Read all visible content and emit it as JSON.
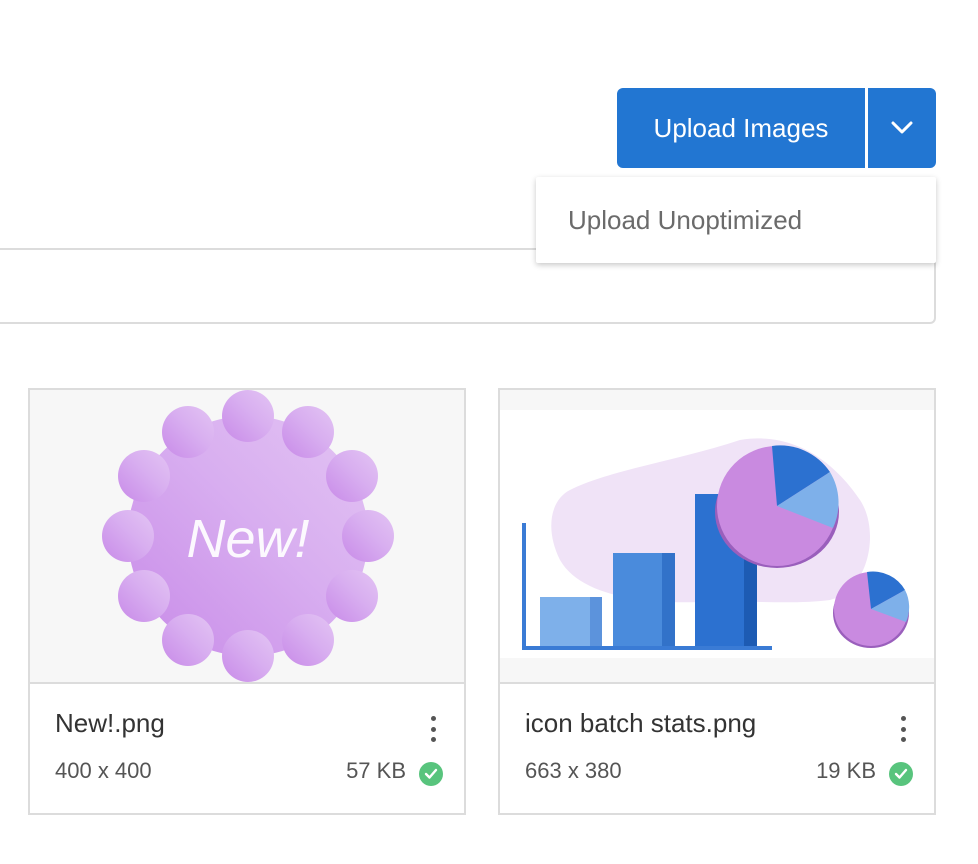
{
  "toolbar": {
    "upload_label": "Upload Images",
    "dropdown_icon": "chevron-down-icon",
    "dropdown_items": [
      "Upload Unoptimized"
    ]
  },
  "images": [
    {
      "name": "New!.png",
      "dimensions": "400 x 400",
      "size": "57 KB",
      "status_icon": "check-circle-icon",
      "badge_text": "New!"
    },
    {
      "name": "icon batch stats.png",
      "dimensions": "663 x 380",
      "size": "19 KB",
      "status_icon": "check-circle-icon"
    }
  ],
  "colors": {
    "primary": "#2276d2",
    "success": "#58c47d",
    "border": "#dcdcdc"
  }
}
